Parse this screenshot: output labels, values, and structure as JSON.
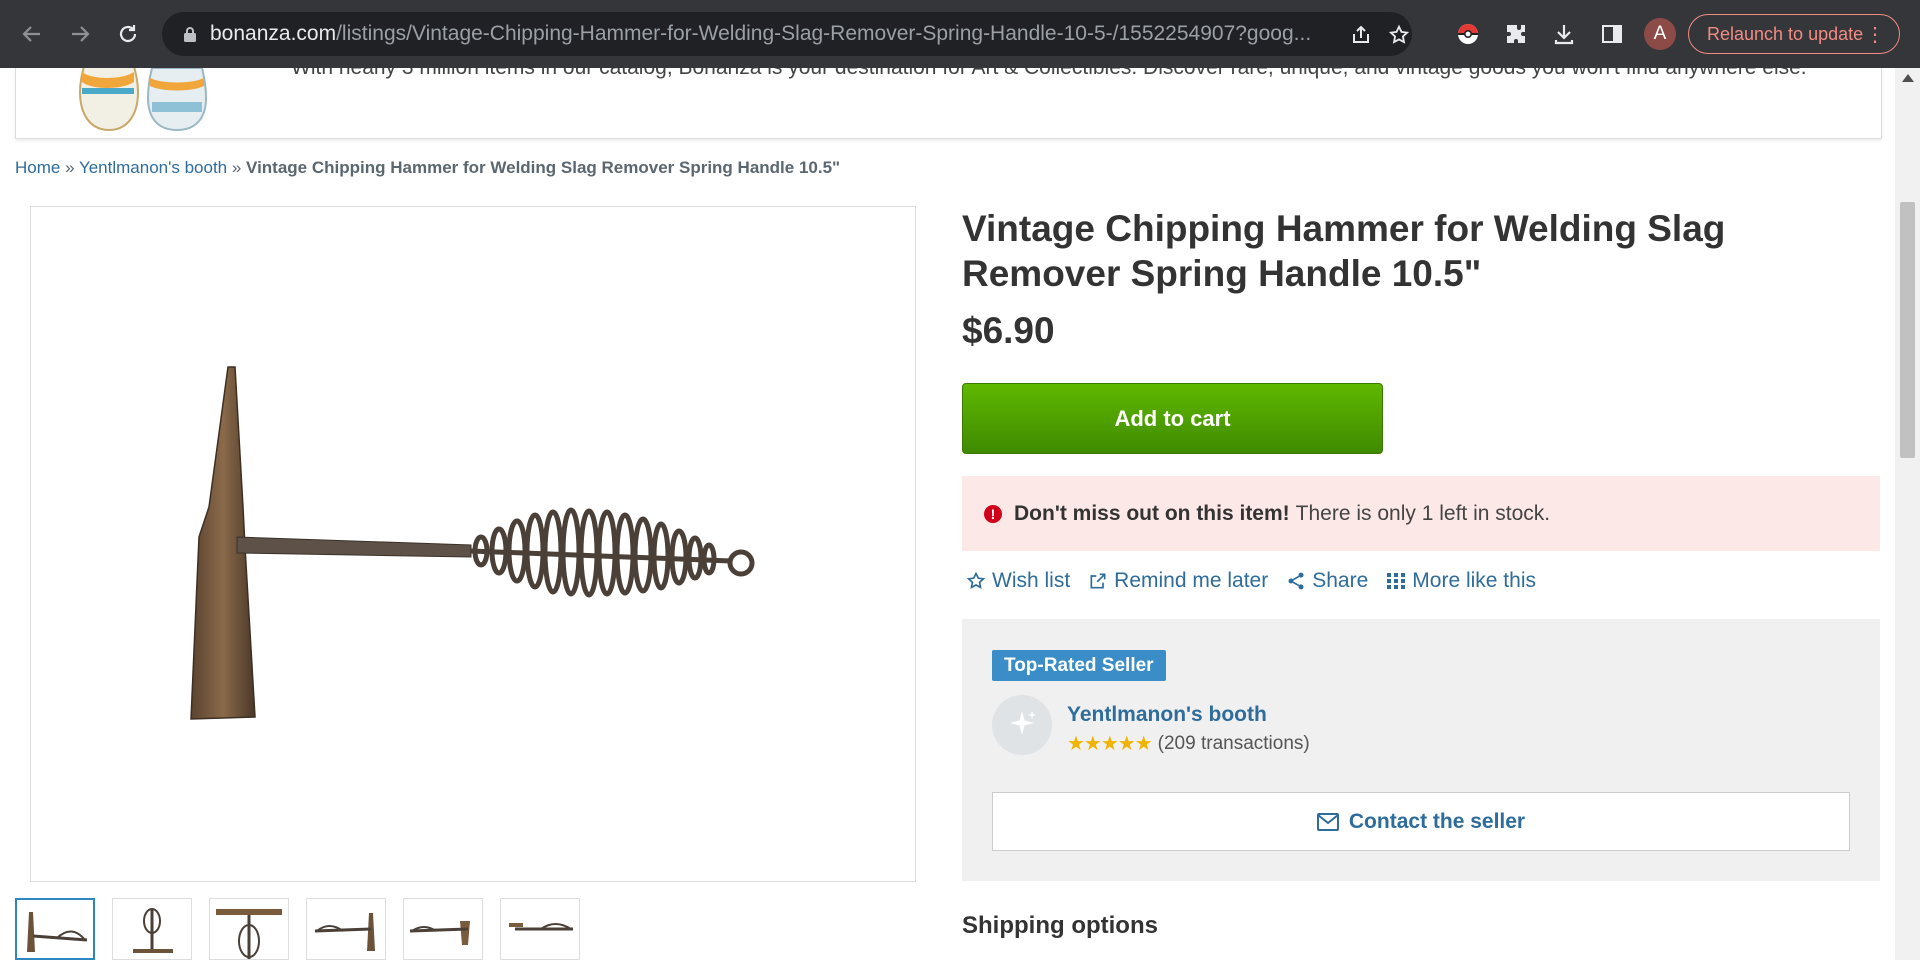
{
  "browser": {
    "url_host": "bonanza.com",
    "url_path": "/listings/Vintage-Chipping-Hammer-for-Welding-Slag-Remover-Spring-Handle-10-5-/1552254907?goog...",
    "profile_initial": "A",
    "relaunch_label": "Relaunch to update"
  },
  "banner": {
    "text": "With nearly 3 million items in our catalog, Bonanza is your destination for Art & Collectibles. Discover rare, unique, and vintage goods you won't find anywhere else."
  },
  "breadcrumb": {
    "home": "Home",
    "sep": " » ",
    "booth": "Yentlmanon's booth",
    "current": "Vintage Chipping Hammer for Welding Slag Remover Spring Handle 10.5\""
  },
  "product": {
    "title": "Vintage Chipping Hammer for Welding Slag Remover Spring Handle 10.5\"",
    "price": "$6.90",
    "add_to_cart": "Add to cart"
  },
  "stock_alert": {
    "strong": "Don't miss out on this item!",
    "rest": "There is only 1 left in stock."
  },
  "actions": {
    "wish_list": "Wish list",
    "remind": "Remind me later",
    "share": "Share",
    "more_like": "More like this"
  },
  "seller": {
    "badge": "Top-Rated Seller",
    "name": "Yentlmanon's booth",
    "stars": "★★★★★",
    "transactions": "(209 transactions)",
    "contact": "Contact the seller"
  },
  "shipping": {
    "heading": "Shipping options"
  },
  "colors": {
    "link": "#2e6c9b",
    "cart_green": "#4fa300",
    "alert_bg": "#fde8e8",
    "badge_blue": "#3a8dc6"
  }
}
